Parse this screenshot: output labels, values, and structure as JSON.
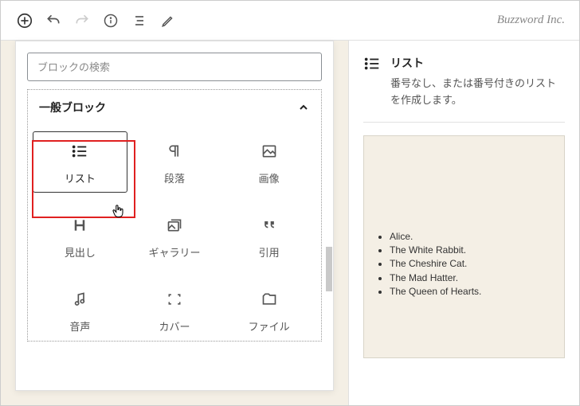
{
  "brand": "Buzzword Inc.",
  "search": {
    "placeholder": "ブロックの検索"
  },
  "category": {
    "title": "一般ブロック"
  },
  "blocks": [
    {
      "label": "リスト"
    },
    {
      "label": "段落"
    },
    {
      "label": "画像"
    },
    {
      "label": "見出し"
    },
    {
      "label": "ギャラリー"
    },
    {
      "label": "引用"
    },
    {
      "label": "音声"
    },
    {
      "label": "カバー"
    },
    {
      "label": "ファイル"
    }
  ],
  "sidebar": {
    "title": "リスト",
    "desc": "番号なし、または番号付きのリストを作成します。"
  },
  "preview": {
    "items": [
      "Alice.",
      "The White Rabbit.",
      "The Cheshire Cat.",
      "The Mad Hatter.",
      "The Queen of Hearts."
    ]
  }
}
